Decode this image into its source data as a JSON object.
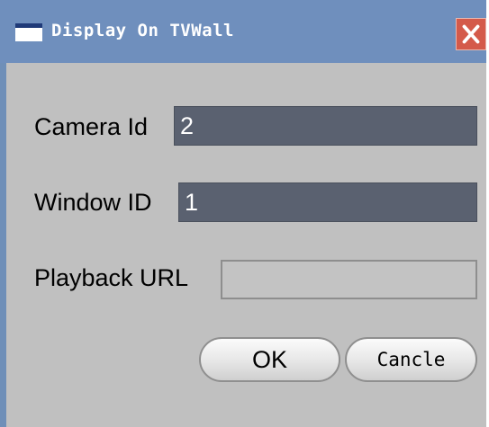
{
  "window": {
    "title": "Display On TVWall",
    "icon": "window-icon",
    "close_icon": "close-icon"
  },
  "form": {
    "camera_id": {
      "label": "Camera Id",
      "value": "2"
    },
    "window_id": {
      "label": "Window ID",
      "value": "1"
    },
    "playback_url": {
      "label": "Playback URL",
      "value": ""
    }
  },
  "buttons": {
    "ok_label": "OK",
    "cancel_label": "Cancle"
  },
  "colors": {
    "titlebar": "#6f8fbd",
    "client_background": "#c0c0c0",
    "filled_field": "#5a6170",
    "close_button": "#d45a4a"
  }
}
